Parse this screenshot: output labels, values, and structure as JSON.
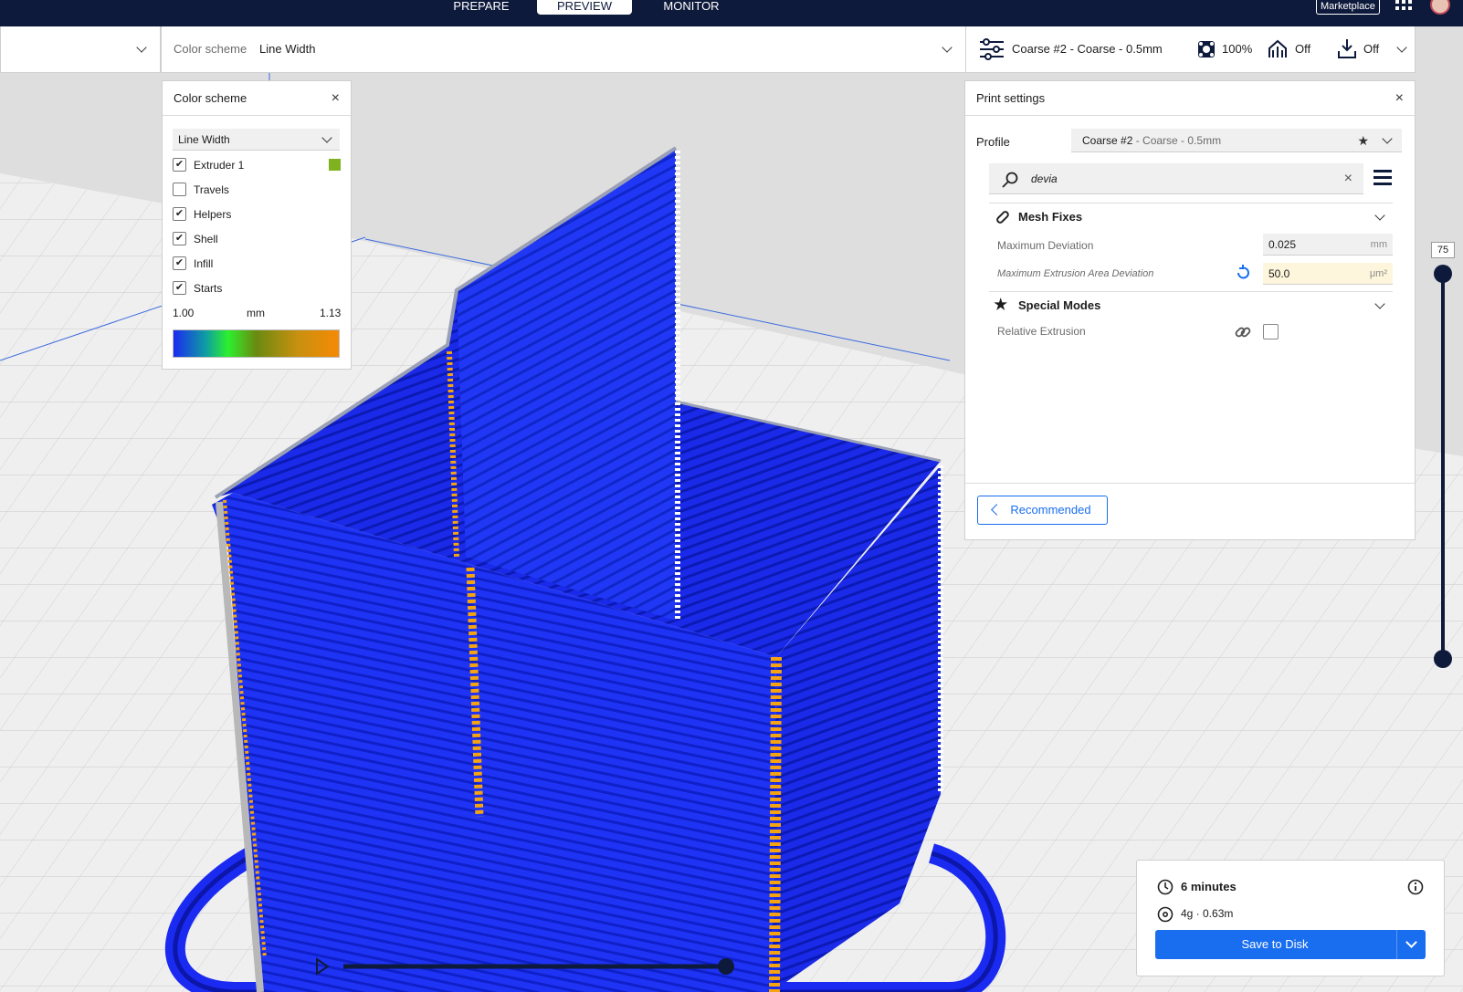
{
  "stages": {
    "prepare": "PREPARE",
    "preview": "PREVIEW",
    "monitor": "MONITOR",
    "marketplace": "Marketplace"
  },
  "view_bar": {
    "color_scheme_label": "Color scheme",
    "color_scheme_value": "Line Width"
  },
  "print_bar": {
    "profile": "Coarse #2 - Coarse - 0.5mm",
    "infill": "100%",
    "support": "Off",
    "adhesion": "Off"
  },
  "color_panel": {
    "title": "Color scheme",
    "dropdown": "Line Width",
    "items": [
      {
        "label": "Extruder 1",
        "checked": true
      },
      {
        "label": "Travels",
        "checked": false
      },
      {
        "label": "Helpers",
        "checked": true
      },
      {
        "label": "Shell",
        "checked": true
      },
      {
        "label": "Infill",
        "checked": true
      },
      {
        "label": "Starts",
        "checked": true
      }
    ],
    "extruder_color": "#7fb21e",
    "range_min": "1.00",
    "range_unit": "mm",
    "range_max": "1.13"
  },
  "print_settings": {
    "title": "Print settings",
    "profile_label": "Profile",
    "profile_name": "Coarse #2",
    "profile_detail": " - Coarse - 0.5mm",
    "search_value": "devia",
    "categories": [
      {
        "title": "Mesh Fixes"
      },
      {
        "title": "Special Modes"
      }
    ],
    "settings": [
      {
        "label": "Maximum Deviation",
        "value": "0.025",
        "unit": "mm"
      },
      {
        "label": "Maximum Extrusion Area Deviation",
        "value": "50.0",
        "unit": "μm²"
      },
      {
        "label": "Relative Extrusion"
      }
    ],
    "recommended_label": "Recommended"
  },
  "layer_slider": {
    "value": "75"
  },
  "estimate": {
    "time": "6 minutes",
    "material": "4g · 0.63m",
    "save_label": "Save to Disk"
  },
  "colors": {
    "accent": "#196ef0",
    "topbar": "#0e1a3c",
    "model": "#1a2af0",
    "seam": "#f5a40f"
  }
}
